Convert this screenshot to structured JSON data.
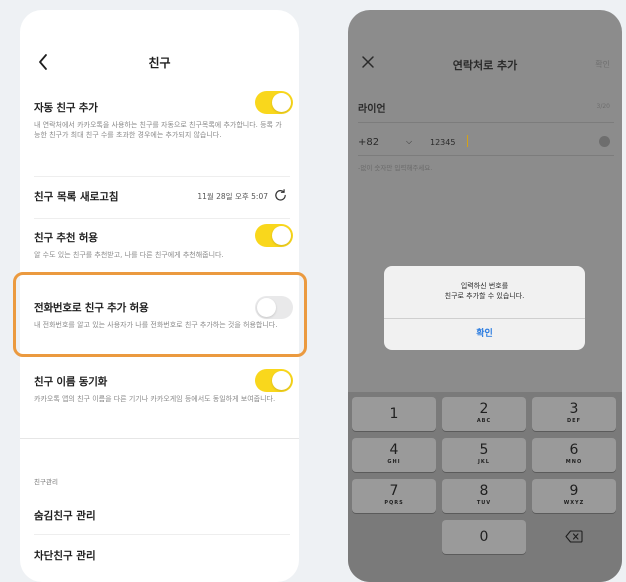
{
  "left": {
    "nav_title": "친구",
    "auto_add": {
      "label": "자동 친구 추가",
      "desc": "내 연락처에서 카카오톡을 사용하는 친구를 자동으로 친구목록에 추가합니다. 등록 가능한 친구가 최대 친구 수를 초과한 경우에는 추가되지 않습니다.",
      "enabled": true
    },
    "refresh": {
      "label": "친구 목록 새로고침",
      "timestamp": "11월 28일 오후 5:07"
    },
    "recommend": {
      "label": "친구 추천 허용",
      "desc": "알 수도 있는 친구를 추천받고, 나를 다른 친구에게 추천해줍니다.",
      "enabled": true
    },
    "phone_add": {
      "label": "전화번호로 친구 추가 허용",
      "desc": "내 전화번호를 알고 있는 사용자가 나를 전화번호로 친구 추가하는 것을 허용합니다.",
      "enabled": false
    },
    "name_sync": {
      "label": "친구 이름 동기화",
      "desc": "카카오톡 앱의 친구 이름을 다른 기기나 카카오게임 등에서도 동일하게 보여줍니다.",
      "enabled": true
    },
    "manage_section": "친구관리",
    "hidden_manage": "숨김친구 관리",
    "blocked_manage": "차단친구 관리",
    "highlight_color": "#eb9a3f",
    "toggle_on_color": "#f9d71c"
  },
  "right": {
    "nav_title": "연락처로 추가",
    "confirm_label": "확인",
    "name_value": "라이언",
    "name_counter": "3/20",
    "country_code": "+82",
    "phone_value": "12345",
    "hint": "-없이 숫자만 입력해주세요.",
    "dialog": {
      "line1": "입력하신 번호를",
      "line2": "친구로 추가할 수 있습니다.",
      "button": "확인"
    },
    "keypad": {
      "keys": [
        {
          "num": "1",
          "letters": ""
        },
        {
          "num": "2",
          "letters": "ABC"
        },
        {
          "num": "3",
          "letters": "DEF"
        },
        {
          "num": "4",
          "letters": "GHI"
        },
        {
          "num": "5",
          "letters": "JKL"
        },
        {
          "num": "6",
          "letters": "MNO"
        },
        {
          "num": "7",
          "letters": "PQRS"
        },
        {
          "num": "8",
          "letters": "TUV"
        },
        {
          "num": "9",
          "letters": "WXYZ"
        },
        {
          "num": "0",
          "letters": ""
        }
      ]
    }
  }
}
